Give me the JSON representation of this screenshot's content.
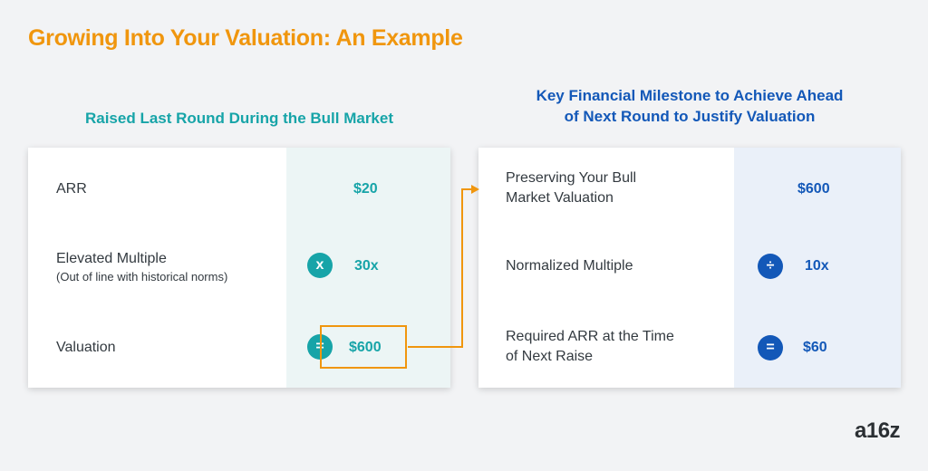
{
  "title": "Growing Into Your Valuation: An Example",
  "left": {
    "heading": "Raised Last Round During the Bull Market",
    "rows": [
      {
        "label": "ARR",
        "note": "",
        "operator": "",
        "value": "$20"
      },
      {
        "label": "Elevated Multiple",
        "note": "(Out of line with historical norms)",
        "operator": "x",
        "value": "30x"
      },
      {
        "label": "Valuation",
        "note": "",
        "operator": "=",
        "value": "$600"
      }
    ]
  },
  "right": {
    "heading_lines": [
      "Key Financial Milestone to Achieve Ahead",
      "of Next Round to Justify Valuation"
    ],
    "rows": [
      {
        "label_lines": [
          "Preserving Your Bull",
          "Market Valuation"
        ],
        "operator": "",
        "value": "$600"
      },
      {
        "label_lines": [
          "Normalized Multiple"
        ],
        "operator": "÷",
        "value": "10x"
      },
      {
        "label_lines": [
          "Required ARR at the Time",
          "of Next Raise"
        ],
        "operator": "=",
        "value": "$60"
      }
    ]
  },
  "colors": {
    "title": "#f0960e",
    "teal": "#17a4a8",
    "blue": "#1358b8",
    "connector": "#f0960e"
  },
  "logo": "a16z"
}
